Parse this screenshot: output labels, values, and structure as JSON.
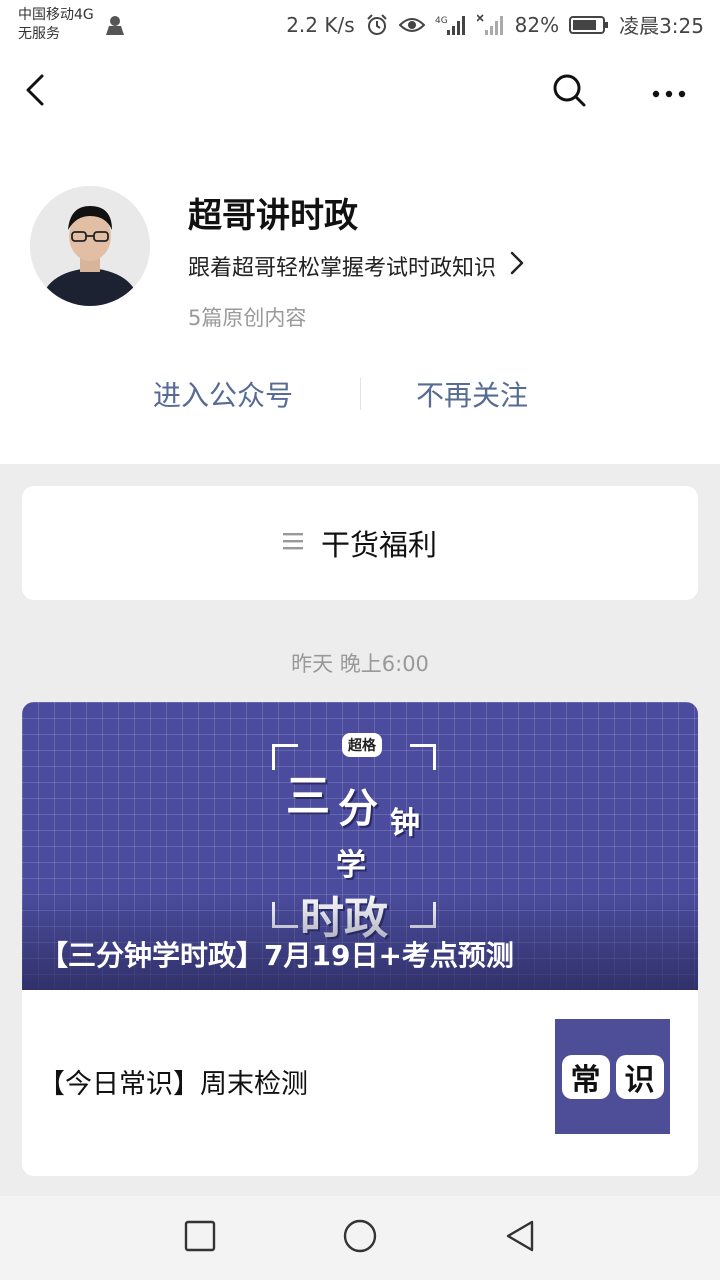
{
  "status_bar": {
    "carrier_line1": "中国移动4G",
    "carrier_line2": "无服务",
    "net_speed": "2.2 K/s",
    "battery": "82%",
    "time": "凌晨3:25",
    "icons": [
      "sim-icon",
      "alarm-icon",
      "eye-icon",
      "signal-4g-icon",
      "signal-x-icon",
      "battery-icon"
    ]
  },
  "nav": {
    "icons": [
      "back-icon",
      "search-icon",
      "more-icon"
    ]
  },
  "profile": {
    "name": "超哥讲时政",
    "description": "跟着超哥轻松掌握考试时政知识",
    "original_count": "5篇原创内容",
    "enter_label": "进入公众号",
    "unfollow_label": "不再关注"
  },
  "menu": {
    "label": "干货福利",
    "icon": "menu-lines-icon"
  },
  "feed": {
    "timestamp": "昨天 晚上6:00",
    "main_article": {
      "title": "【三分钟学时政】7月19日+考点预测",
      "cover_badge": "超格",
      "cover_words": [
        "三",
        "分",
        "钟",
        "学",
        "时政"
      ]
    },
    "sub_article": {
      "title": "【今日常识】周末检测",
      "thumb_chars": [
        "常",
        "识"
      ]
    }
  },
  "system_nav": {
    "icons": [
      "recent-apps-icon",
      "home-icon",
      "back-triangle-icon"
    ]
  },
  "colors": {
    "link": "#576b95",
    "cover_bg": "#4b4c9d",
    "page_bg": "#ededed"
  }
}
